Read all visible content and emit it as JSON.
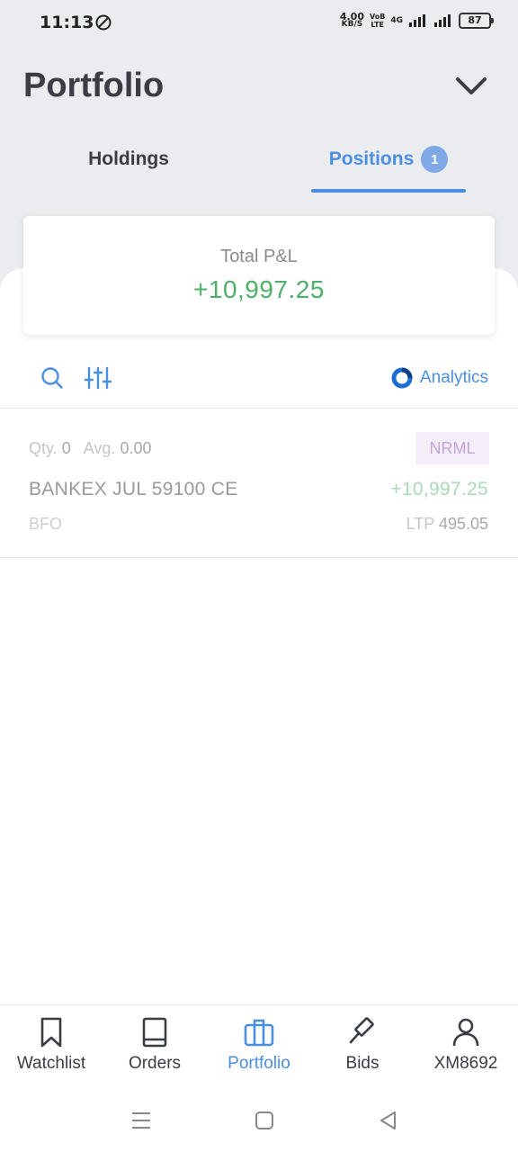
{
  "status_bar": {
    "time": "11:13",
    "net_speed_value": "4.00",
    "net_speed_unit": "KB/S",
    "volte_line1": "VoB",
    "volte_line2": "LTE",
    "network_type": "4G",
    "battery": "87"
  },
  "header": {
    "title": "Portfolio",
    "dropdown_icon": "chevron-down-icon"
  },
  "tabs": {
    "holdings_label": "Holdings",
    "positions_label": "Positions",
    "positions_count": "1",
    "active": "positions",
    "accent_color": "#4a8fe0"
  },
  "summary": {
    "label": "Total P&L",
    "value": "+10,997.25",
    "value_color": "#4caf6a"
  },
  "toolbar": {
    "search_icon": "search-icon",
    "filter_icon": "sliders-icon",
    "analytics_label": "Analytics"
  },
  "positions": [
    {
      "qty_label": "Qty.",
      "qty": "0",
      "avg_label": "Avg.",
      "avg": "0.00",
      "product": "NRML",
      "symbol": "BANKEX JUL 59100 CE",
      "pnl": "+10,997.25",
      "exchange": "BFO",
      "ltp_label": "LTP",
      "ltp": "495.05"
    }
  ],
  "bottom_nav": [
    {
      "label": "Watchlist",
      "icon": "bookmark-icon"
    },
    {
      "label": "Orders",
      "icon": "book-icon"
    },
    {
      "label": "Portfolio",
      "icon": "briefcase-icon",
      "active": true
    },
    {
      "label": "Bids",
      "icon": "gavel-icon"
    },
    {
      "label": "XM8692",
      "icon": "user-icon"
    }
  ]
}
